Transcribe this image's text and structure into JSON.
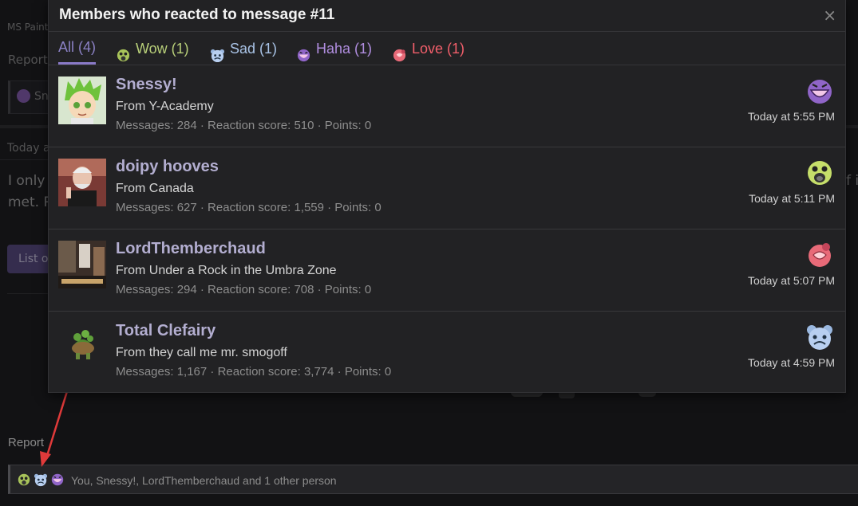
{
  "background": {
    "ms_paint": "MS Paint",
    "report_top": "Report",
    "reactor_snippet": "Sn",
    "today_snippet": "Today a",
    "post_line1_left": "I only",
    "post_line1_right": "f i",
    "post_line2_left": "met. P",
    "list_button": "List o",
    "report_bottom": "Report"
  },
  "modal": {
    "title": "Members who reacted to message #11",
    "close_glyph": "×",
    "tabs": [
      {
        "label": "All (4)",
        "color": "#8c82c6",
        "icon": ""
      },
      {
        "label": "Wow (1)",
        "color": "#b9d07a",
        "icon": "wow-icon"
      },
      {
        "label": "Sad (1)",
        "color": "#a9c3e6",
        "icon": "sad-icon"
      },
      {
        "label": "Haha (1)",
        "color": "#b18ee0",
        "icon": "haha-icon"
      },
      {
        "label": "Love (1)",
        "color": "#f25f6b",
        "icon": "love-icon"
      }
    ],
    "members": [
      {
        "name": "Snessy!",
        "location": "From Y-Academy",
        "stats": "Messages: 284 · Reaction score: 510 · Points: 0",
        "time": "Today at 5:55 PM",
        "reaction": "haha-icon"
      },
      {
        "name": "doipy hooves",
        "location": "From Canada",
        "stats": "Messages: 627 · Reaction score: 1,559 · Points: 0",
        "time": "Today at 5:11 PM",
        "reaction": "wow-icon"
      },
      {
        "name": "LordThemberchaud",
        "location": "From Under a Rock in the Umbra Zone",
        "stats": "Messages: 294 · Reaction score: 708 · Points: 0",
        "time": "Today at 5:07 PM",
        "reaction": "love-icon"
      },
      {
        "name": "Total Clefairy",
        "location": "From they call me mr. smogoff",
        "stats": "Messages: 1,167 · Reaction score: 3,774 · Points: 0",
        "time": "Today at 4:59 PM",
        "reaction": "sad-icon"
      }
    ]
  },
  "reactions_bar": {
    "icons": [
      "wow-icon",
      "sad-icon",
      "haha-icon"
    ],
    "text": "You, Snessy!, LordThemberchaud and 1 other person"
  },
  "colors": {
    "accent": "#8a7ac8",
    "name_color": "#b3aed0",
    "annotation_arrow": "#e03a3a"
  }
}
